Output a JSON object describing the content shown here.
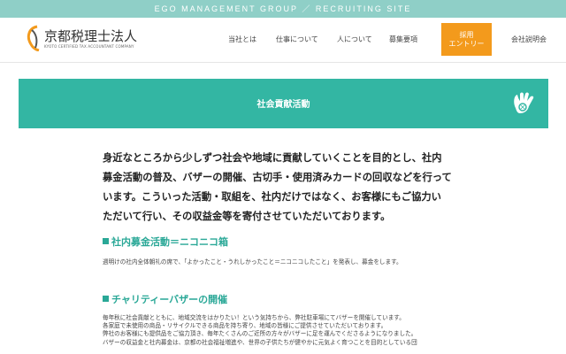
{
  "topbar": {
    "text": "EGO MANAGEMENT GROUP  ／  RECRUITING SITE"
  },
  "logo": {
    "title": "京都税理士法人",
    "subtitle": "KYOTO CERTIFIED TAX ACCOUNTANT COMPANY"
  },
  "nav": {
    "items": [
      "当社とは",
      "仕事について",
      "人について",
      "募集要項"
    ],
    "cta_line1": "採用",
    "cta_line2": "エントリー",
    "last": "会社説明会"
  },
  "banner": {
    "title": "社会貢献活動",
    "icon": "baseball-glove-icon"
  },
  "lead": {
    "lines": [
      "身近なところから少しずつ社会や地域に貢献していくことを目的とし、社内",
      "募金活動の普及、バザーの開催、古切手・使用済みカードの回収などを行って",
      "います。こういった活動・取組を、社内だけではなく、お客様にもご協力い",
      "ただいて行い、その収益金等を寄付させていただいております。"
    ]
  },
  "sections": [
    {
      "heading": "社内募金活動＝ニコニコ箱",
      "lines": [
        "週明けの社内全体朝礼の席で、「よかったこと・うれしかったこと＝ニコニコしたこと」を発表し、募金をします。"
      ]
    },
    {
      "heading": "チャリティーバザーの開催",
      "lines": [
        "毎年秋に社会貢献とともに、地域交流をはかりたい！という気持ちから、弊社駐車場にてバザーを開催しています。",
        "各家庭で未使用の商品・リサイクルできる商品を持ち寄り、地域の皆様にご提供させていただいております。",
        "弊社のお客様にも提供品をご協力頂き、毎年たくさんのご近所の方々がバザーに足を運んでくださるようになりました。",
        "バザーの収益金と社内募金は、京都の社会福祉増進や、世界の子供たちが健やかに元気よく育つことを目的としている団"
      ]
    }
  ],
  "colors": {
    "teal": "#33b6a3",
    "topbar": "#8fcfc7",
    "cta": "#f39a1c",
    "accent_text": "#2aa897"
  }
}
